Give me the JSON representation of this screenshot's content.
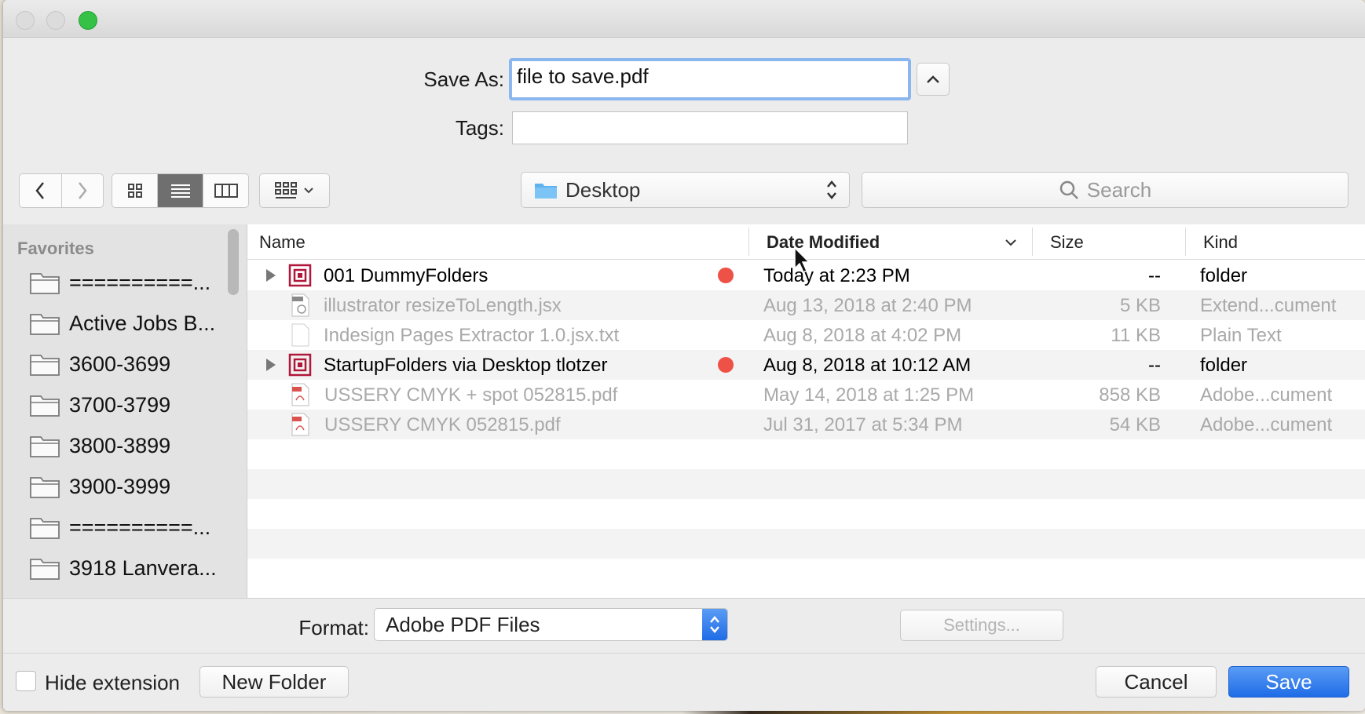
{
  "save_as": {
    "label": "Save As:",
    "value": "file to save.pdf"
  },
  "tags": {
    "label": "Tags:",
    "value": ""
  },
  "location": {
    "current": "Desktop"
  },
  "search": {
    "placeholder": "Search"
  },
  "sidebar": {
    "title": "Favorites",
    "items": [
      {
        "label": "==========..."
      },
      {
        "label": "Active Jobs B..."
      },
      {
        "label": "3600-3699"
      },
      {
        "label": "3700-3799"
      },
      {
        "label": "3800-3899"
      },
      {
        "label": "3900-3999"
      },
      {
        "label": "==========..."
      },
      {
        "label": "3918 Lanvera..."
      }
    ]
  },
  "columns": {
    "name": "Name",
    "date": "Date Modified",
    "size": "Size",
    "kind": "Kind"
  },
  "files": [
    {
      "name": "001 DummyFolders",
      "date": "Today at 2:23 PM",
      "size": "--",
      "kind": "folder",
      "type": "folder",
      "tag": "red",
      "enabled": true
    },
    {
      "name": "illustrator resizeToLength.jsx",
      "date": "Aug 13, 2018 at 2:40 PM",
      "size": "5 KB",
      "kind": "Extend...cument",
      "type": "jsx",
      "enabled": false
    },
    {
      "name": "Indesign Pages Extractor 1.0.jsx.txt",
      "date": "Aug 8, 2018 at 4:02 PM",
      "size": "11 KB",
      "kind": "Plain Text",
      "type": "txt",
      "enabled": false
    },
    {
      "name": "StartupFolders via Desktop tlotzer",
      "date": "Aug 8, 2018 at 10:12 AM",
      "size": "--",
      "kind": "folder",
      "type": "folder",
      "tag": "red",
      "enabled": true
    },
    {
      "name": "USSERY CMYK + spot 052815.pdf",
      "date": "May 14, 2018 at 1:25 PM",
      "size": "858 KB",
      "kind": "Adobe...cument",
      "type": "pdf",
      "enabled": false
    },
    {
      "name": "USSERY CMYK 052815.pdf",
      "date": "Jul 31, 2017 at 5:34 PM",
      "size": "54 KB",
      "kind": "Adobe...cument",
      "type": "pdf",
      "enabled": false
    }
  ],
  "format": {
    "label": "Format:",
    "value": "Adobe PDF Files"
  },
  "buttons": {
    "settings": "Settings...",
    "new_folder": "New Folder",
    "cancel": "Cancel",
    "save": "Save"
  },
  "hide_extension": {
    "label": "Hide extension",
    "checked": false
  },
  "colors": {
    "accent": "#1f6ce6",
    "tag_red": "#ee5146",
    "folder_icon": "#b0173a"
  }
}
